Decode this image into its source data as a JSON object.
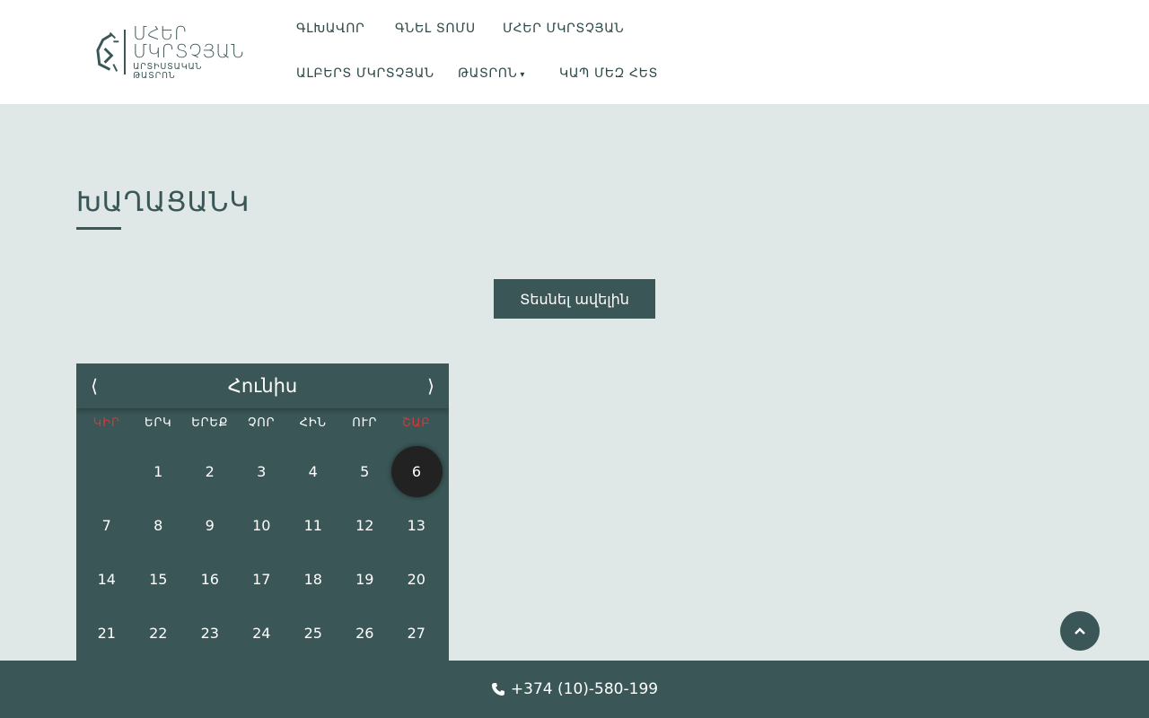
{
  "logo": {
    "line1": "ՄՀԵՐ",
    "line2": "ՄԿՐՏՉՅԱՆ",
    "sub": "ԱՐՏԻՍՏԱԿԱՆ ԹԱՏՐՈՆ"
  },
  "nav": {
    "home": "ԳԼԽԱՎՈՐ",
    "tickets": "ԳՆԵԼ ՏՈՄՍ",
    "mher": "ՄՀԵՐ ՄԿՐՏՉՅԱՆ",
    "albert": "ԱԼԲԵՐՏ ՄԿՐՏՉՅԱՆ",
    "theatre": "ԹԱՏՐՈՆ",
    "contact": "ԿԱՊ ՄԵԶ ՀԵՏ"
  },
  "page": {
    "title": "ԽԱՂԱՑԱՆԿ",
    "see_more": "Տեսնել ավելին"
  },
  "calendar": {
    "month": "Հունիս",
    "prev": "⟨",
    "next": "⟩",
    "weekdays": [
      "ԿԻՐ",
      "ԵՐԿ",
      "ԵՐԵՔ",
      "ՉՈՐ",
      "ՀԻՆ",
      "ՈՒՐ",
      "ՇԱԲ"
    ],
    "weeks": [
      [
        "",
        "1",
        "2",
        "3",
        "4",
        "5",
        "6"
      ],
      [
        "7",
        "8",
        "9",
        "10",
        "11",
        "12",
        "13"
      ],
      [
        "14",
        "15",
        "16",
        "17",
        "18",
        "19",
        "20"
      ],
      [
        "21",
        "22",
        "23",
        "24",
        "25",
        "26",
        "27"
      ]
    ],
    "today": "6"
  },
  "footer": {
    "phone": "+374 (10)-580-199"
  },
  "colors": {
    "accent": "#3a5656",
    "background": "#dfe8e7",
    "weekend": "#d23a3a",
    "today": "#222222"
  },
  "icons": {
    "scroll_top": "chevron-up-icon",
    "phone": "phone-icon"
  }
}
